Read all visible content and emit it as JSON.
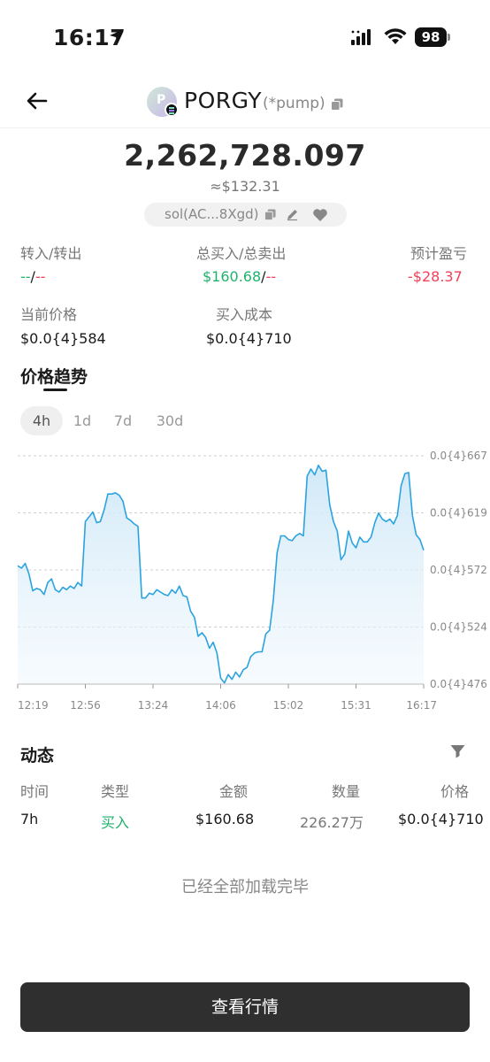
{
  "status_bar": {
    "time": "16:17",
    "battery": "98",
    "icons": [
      "location-arrow-icon",
      "signal-icon",
      "wifi-icon",
      "battery-icon"
    ]
  },
  "header": {
    "avatar_letter": "P",
    "token_name": "PORGY",
    "token_tag": "(*pump)",
    "balance": "2,262,728.097",
    "balance_usd": "≈$132.31",
    "address": "sol(AC...8Xgd)"
  },
  "stats": {
    "transfer_label": "转入/转出",
    "transfer_in": "--",
    "transfer_sep": "/",
    "transfer_out": "--",
    "trade_label": "总买入/总卖出",
    "total_buy": "$160.68",
    "trade_sep": "/",
    "total_sell": "--",
    "pnl_label": "预计盈亏",
    "pnl_value": "-$28.37",
    "price_label": "当前价格",
    "price_value": "$0.0{4}584",
    "cost_label": "买入成本",
    "cost_value": "$0.0{4}710"
  },
  "trend": {
    "tab_label": "价格趋势",
    "ranges": [
      "4h",
      "1d",
      "7d",
      "30d"
    ],
    "active_range": "4h"
  },
  "chart_data": {
    "type": "area",
    "x_ticks": [
      "12:19",
      "12:56",
      "13:24",
      "14:06",
      "15:02",
      "15:31",
      "16:17"
    ],
    "y_ticks": [
      "0.0{4}667",
      "0.0{4}619",
      "0.0{4}572",
      "0.0{4}524",
      "0.0{4}476"
    ],
    "ylim": [
      4.76e-05,
      6.67e-05
    ],
    "series": [
      {
        "color": "#2ba3e0",
        "values": [
          5.75e-05,
          5.73e-05,
          5.77e-05,
          5.68e-05,
          5.54e-05,
          5.56e-05,
          5.55e-05,
          5.51e-05,
          5.61e-05,
          5.64e-05,
          5.55e-05,
          5.53e-05,
          5.57e-05,
          5.55e-05,
          5.58e-05,
          5.56e-05,
          5.61e-05,
          5.58e-05,
          6.12e-05,
          6.16e-05,
          6.2e-05,
          6.11e-05,
          6.12e-05,
          6.22e-05,
          6.35e-05,
          6.35e-05,
          6.36e-05,
          6.34e-05,
          6.29e-05,
          6.15e-05,
          6.13e-05,
          6.1e-05,
          6.08e-05,
          5.48e-05,
          5.48e-05,
          5.52e-05,
          5.51e-05,
          5.55e-05,
          5.53e-05,
          5.51e-05,
          5.5e-05,
          5.55e-05,
          5.52e-05,
          5.58e-05,
          5.5e-05,
          5.49e-05,
          5.37e-05,
          5.32e-05,
          5.16e-05,
          5.19e-05,
          5.15e-05,
          5.06e-05,
          5.11e-05,
          5.02e-05,
          4.81e-05,
          4.77e-05,
          4.84e-05,
          4.8e-05,
          4.86e-05,
          4.82e-05,
          4.88e-05,
          4.9e-05,
          4.99e-05,
          5.02e-05,
          5.03e-05,
          5.03e-05,
          5.18e-05,
          5.21e-05,
          5.46e-05,
          5.86e-05,
          6e-05,
          6e-05,
          5.97e-05,
          5.96e-05,
          6e-05,
          6.02e-05,
          6e-05,
          6.5e-05,
          6.56e-05,
          6.51e-05,
          6.59e-05,
          6.54e-05,
          6.55e-05,
          6.26e-05,
          6.12e-05,
          6.04e-05,
          5.8e-05,
          5.85e-05,
          6.04e-05,
          5.94e-05,
          5.9e-05,
          5.99e-05,
          5.95e-05,
          5.95e-05,
          5.99e-05,
          6.11e-05,
          6.19e-05,
          6.14e-05,
          6.12e-05,
          6.14e-05,
          6.1e-05,
          6.17e-05,
          6.42e-05,
          6.52e-05,
          6.53e-05,
          6.17e-05,
          6.01e-05,
          5.97e-05,
          5.88e-05
        ]
      }
    ]
  },
  "activity": {
    "title": "动态",
    "columns": [
      "时间",
      "类型",
      "金额",
      "数量",
      "价格"
    ],
    "rows": [
      {
        "time": "7h",
        "type": "买入",
        "amount": "$160.68",
        "quantity": "226.27万",
        "price": "$0.0{4}710"
      }
    ],
    "footer": "已经全部加载完毕"
  },
  "cta_label": "查看行情",
  "colors": {
    "green": "#20b26c",
    "red": "#f0405a",
    "line": "#2ba3e0",
    "button": "#2f2f2f"
  }
}
